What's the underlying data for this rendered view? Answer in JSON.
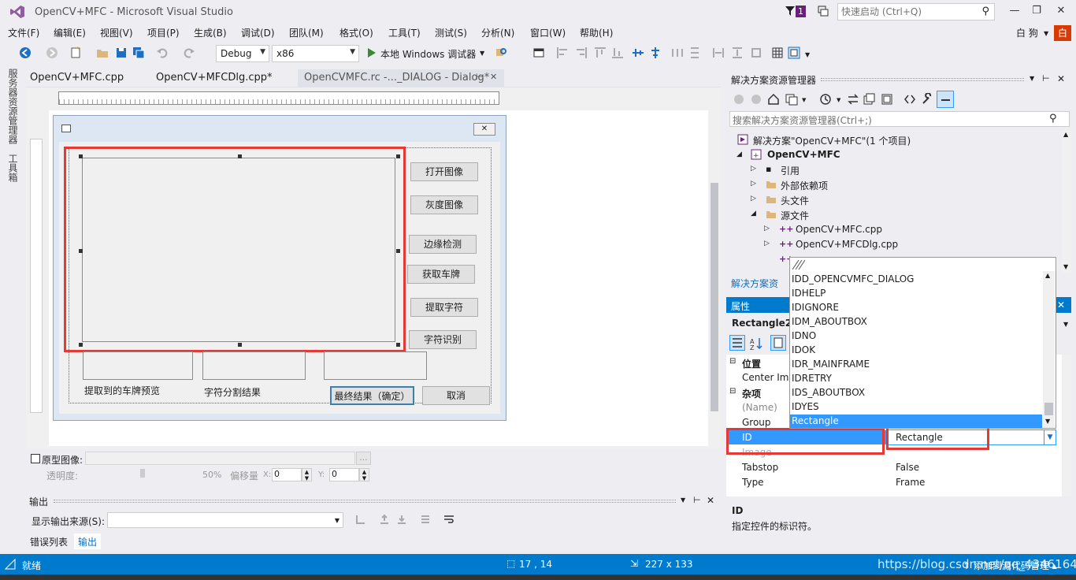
{
  "window": {
    "title": "OpenCV+MFC - Microsoft Visual Studio",
    "notification_count": "1",
    "quick_launch_placeholder": "快速启动 (Ctrl+Q)",
    "user_name": "白 狗",
    "user_initial": "白"
  },
  "menu": [
    "文件(F)",
    "编辑(E)",
    "视图(V)",
    "项目(P)",
    "生成(B)",
    "调试(D)",
    "团队(M)",
    "格式(O)",
    "工具(T)",
    "测试(S)",
    "分析(N)",
    "窗口(W)",
    "帮助(H)"
  ],
  "toolbar": {
    "config": "Debug",
    "platform": "x86",
    "run_label": "本地 Windows 调试器"
  },
  "left_tabs": {
    "server_explorer": "服务器资源管理器",
    "toolbox": "工具箱"
  },
  "doc_tabs": [
    "OpenCV+MFC.cpp",
    "OpenCV+MFCDlg.cpp*",
    "OpenCVMFC.rc -..._DIALOG - Dialog*"
  ],
  "dialog": {
    "buttons": {
      "open_image": "打开图像",
      "gray_image": "灰度图像",
      "edge_detect": "边缘检测",
      "get_plate": "获取车牌",
      "extract_chars": "提取字符",
      "recognize_chars": "字符识别",
      "final_result": "最终结果（确定）",
      "cancel": "取消"
    },
    "labels": {
      "plate_preview": "提取到的车牌预览",
      "segmentation_result": "字符分割结果"
    }
  },
  "image_bar": {
    "prototype_image_label": "原型图像:",
    "browse": "...",
    "transparency_label": "透明度:",
    "transparency_value": "50%",
    "offset_label": "偏移量",
    "x_label": "X:",
    "x_value": "0",
    "y_label": "Y:",
    "y_value": "0"
  },
  "output": {
    "title": "输出",
    "source_label": "显示输出来源(S):",
    "tabs": [
      "错误列表",
      "输出"
    ]
  },
  "solution_explorer": {
    "title": "解决方案资源管理器",
    "search_placeholder": "搜索解决方案资源管理器(Ctrl+;)",
    "items": [
      "解决方案\"OpenCV+MFC\"(1 个项目)",
      "OpenCV+MFC",
      "引用",
      "外部依赖项",
      "头文件",
      "源文件",
      "OpenCV+MFC.cpp",
      "OpenCV+MFCDlg.cpp"
    ],
    "footer_tab": "解决方案资"
  },
  "properties": {
    "title": "属性",
    "object": "Rectangle2",
    "categories": {
      "position": "位置",
      "misc": "杂项"
    },
    "rows": [
      {
        "name": "Center Ima",
        "value": ""
      },
      {
        "name": "(Name)",
        "value": ""
      },
      {
        "name": "Group",
        "value": ""
      },
      {
        "name": "ID",
        "value": "Rectangle"
      },
      {
        "name": "Image",
        "value": ""
      },
      {
        "name": "Tabstop",
        "value": "False"
      },
      {
        "name": "Type",
        "value": "Frame"
      }
    ],
    "desc_title": "ID",
    "desc_text": "指定控件的标识符。"
  },
  "id_dropdown": {
    "items": [
      "IDD_OPENCVMFC_DIALOG",
      "IDHELP",
      "IDIGNORE",
      "IDM_ABOUTBOX",
      "IDNO",
      "IDOK",
      "IDR_MAINFRAME",
      "IDRETRY",
      "IDS_ABOUTBOX",
      "IDYES",
      "Rectangle"
    ],
    "selected": "Rectangle"
  },
  "status": {
    "ready": "就绪",
    "position": "17 , 14",
    "size": "227 x 133",
    "watermark": "https://blog.csdn.net/qq_43461641",
    "source_control": "↑ 添加到源代码管理 ▴"
  },
  "colors": {
    "accent": "#007acc",
    "highlight_red": "#e53935",
    "selection": "#3399ff"
  }
}
